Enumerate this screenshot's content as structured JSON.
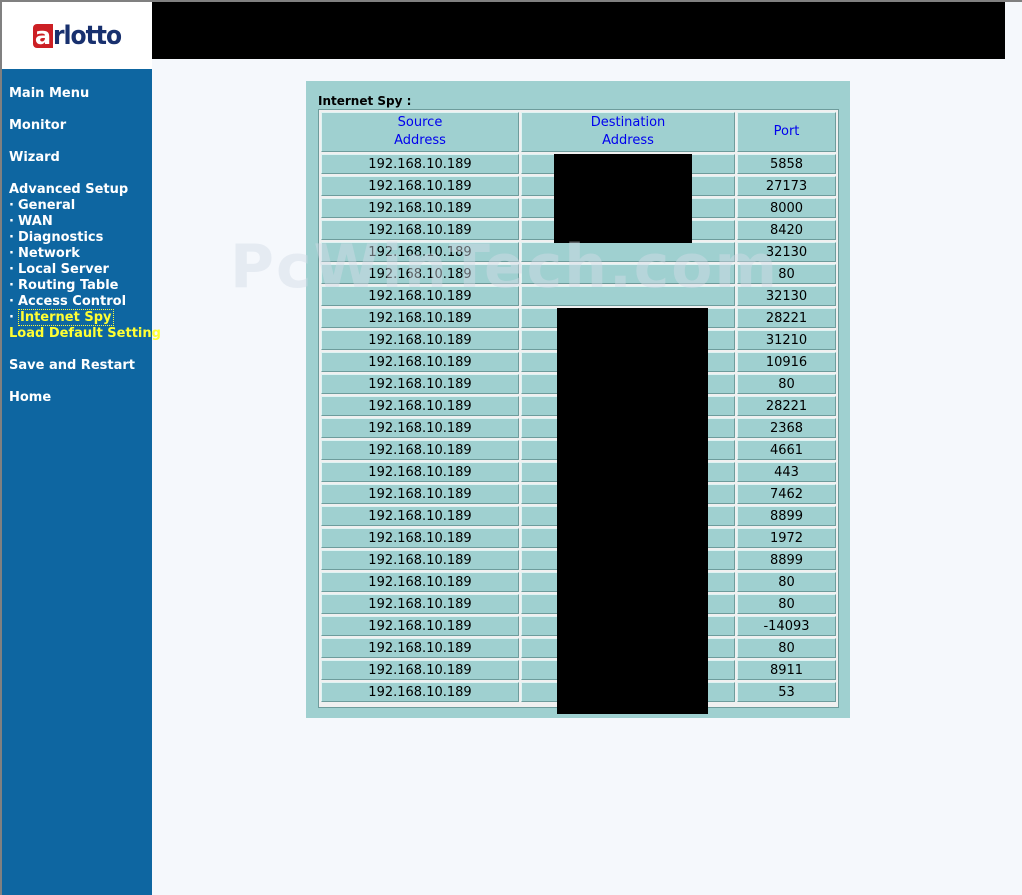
{
  "brand": {
    "logo_initial": "a",
    "logo_rest": "rlotto"
  },
  "nav": {
    "main_menu": "Main Menu",
    "monitor": "Monitor",
    "wizard": "Wizard",
    "advanced_setup": "Advanced Setup",
    "advanced_items": [
      {
        "label": "General"
      },
      {
        "label": "WAN"
      },
      {
        "label": "Diagnostics"
      },
      {
        "label": "Network"
      },
      {
        "label": "Local Server"
      },
      {
        "label": "Routing Table"
      },
      {
        "label": "Access Control"
      },
      {
        "label": "Internet Spy",
        "active": true
      }
    ],
    "bullet": "·",
    "load_default": "Load Default Setting",
    "save_restart": "Save and Restart",
    "home": "Home"
  },
  "spy": {
    "title": "Internet Spy :",
    "headers": {
      "source_1": "Source",
      "source_2": "Address",
      "dest_1": "Destination",
      "dest_2": "Address",
      "port": "Port"
    },
    "rows": [
      {
        "src": "192.168.10.189",
        "port": "5858"
      },
      {
        "src": "192.168.10.189",
        "port": "27173"
      },
      {
        "src": "192.168.10.189",
        "port": "8000"
      },
      {
        "src": "192.168.10.189",
        "port": "8420"
      },
      {
        "src": "192.168.10.189",
        "port": "32130"
      },
      {
        "src": "192.168.10.189",
        "port": "80"
      },
      {
        "src": "192.168.10.189",
        "port": "32130"
      },
      {
        "src": "192.168.10.189",
        "port": "28221"
      },
      {
        "src": "192.168.10.189",
        "port": "31210"
      },
      {
        "src": "192.168.10.189",
        "port": "10916"
      },
      {
        "src": "192.168.10.189",
        "port": "80"
      },
      {
        "src": "192.168.10.189",
        "port": "28221"
      },
      {
        "src": "192.168.10.189",
        "port": "2368"
      },
      {
        "src": "192.168.10.189",
        "port": "4661"
      },
      {
        "src": "192.168.10.189",
        "port": "443"
      },
      {
        "src": "192.168.10.189",
        "port": "7462"
      },
      {
        "src": "192.168.10.189",
        "port": "8899"
      },
      {
        "src": "192.168.10.189",
        "port": "1972"
      },
      {
        "src": "192.168.10.189",
        "port": "8899"
      },
      {
        "src": "192.168.10.189",
        "port": "80"
      },
      {
        "src": "192.168.10.189",
        "port": "80"
      },
      {
        "src": "192.168.10.189",
        "port": "-14093"
      },
      {
        "src": "192.168.10.189",
        "port": "80"
      },
      {
        "src": "192.168.10.189",
        "port": "8911"
      },
      {
        "src": "192.168.10.189",
        "port": "53"
      }
    ]
  },
  "watermark": "PcWinTech.com",
  "colors": {
    "sidebar": "#0e66a1",
    "panel": "#9fd0d0",
    "active_link": "#ffff33",
    "header_text": "#0000ee"
  }
}
